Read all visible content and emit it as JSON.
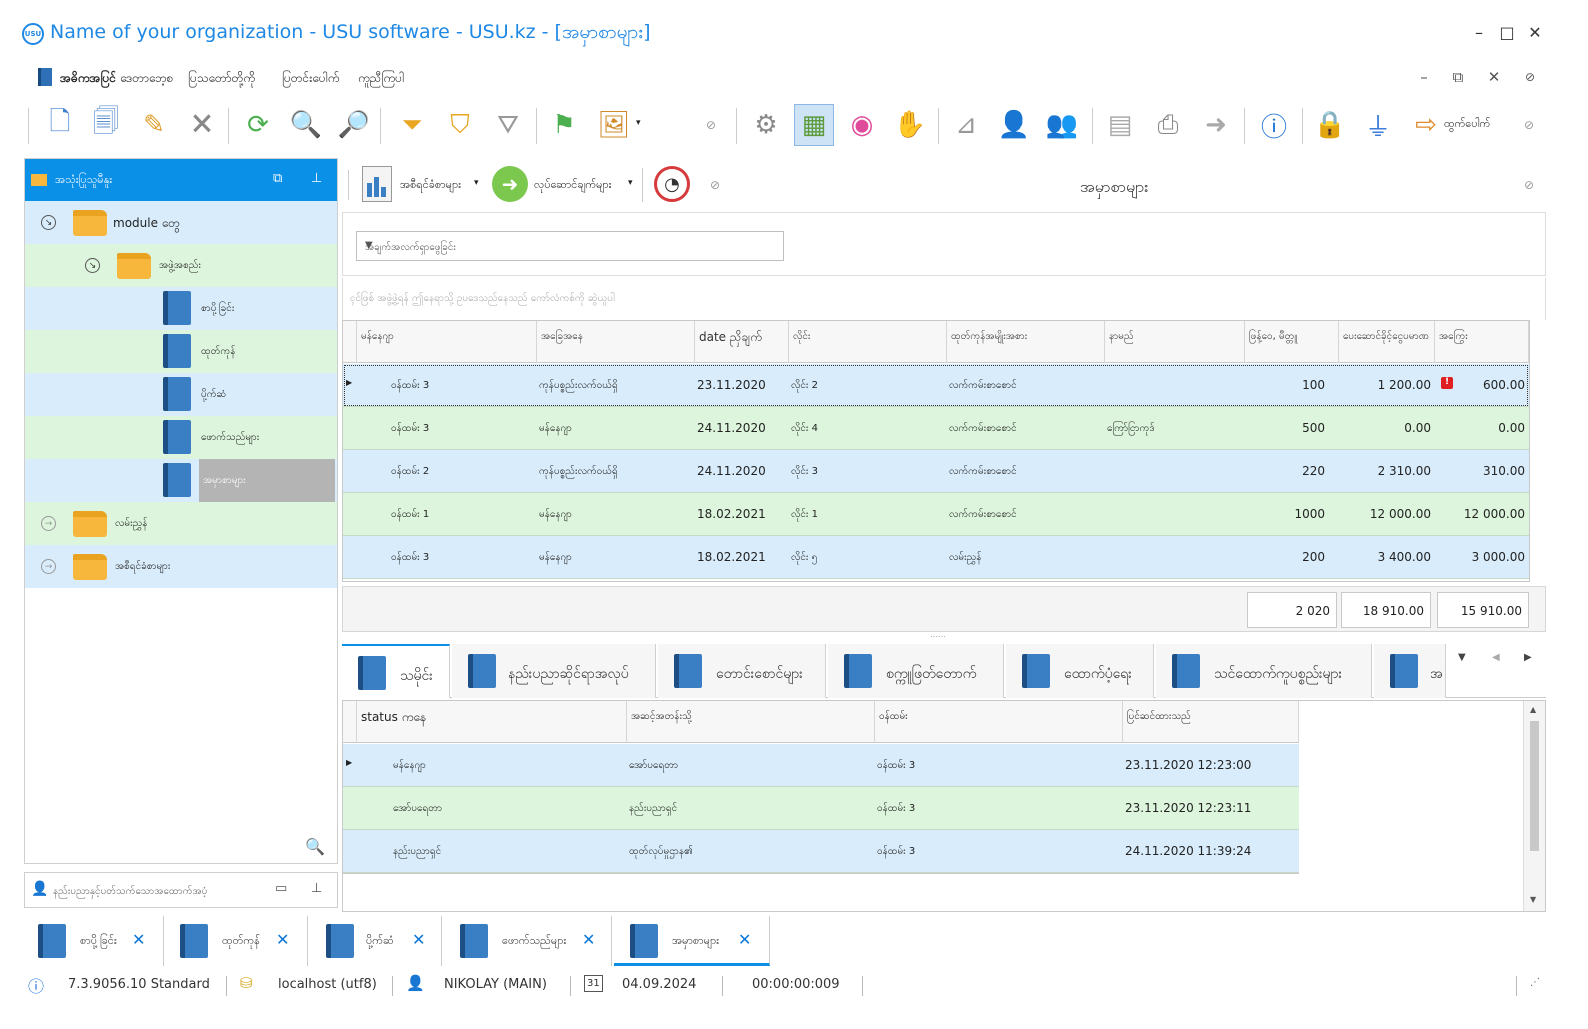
{
  "window": {
    "logo": "USU",
    "title": "Name of your organization - USU software - USU.kz - [အမှာစာများ]",
    "minimize": "–",
    "maximize": "□",
    "close": "✕"
  },
  "menu": {
    "items": [
      "အဓိကအပြင်",
      "ဒေတာဘေ့စ",
      "ပြသတော်တို့ကို",
      "ပြတင်းပေါက်",
      "ကူညီကြပါ"
    ]
  },
  "mdi": {
    "minimize": "–",
    "restore": "⧉",
    "close": "✕"
  },
  "toolbar": {
    "logout_label": "ထွက်ပေါက်"
  },
  "nav": {
    "header": "အသုံးပြုသူမီနူး",
    "tree": [
      {
        "label": "module တွေ",
        "level": 0,
        "kind": "folder",
        "color": "blue"
      },
      {
        "label": "အဖွဲ့အစည်း",
        "level": 1,
        "kind": "folder",
        "color": "green"
      },
      {
        "label": "စာပို့ခြင်း",
        "level": 2,
        "kind": "book",
        "color": "blue"
      },
      {
        "label": "ထုတ်ကုန်",
        "level": 2,
        "kind": "book",
        "color": "green"
      },
      {
        "label": "ပို့က်ဆံ",
        "level": 2,
        "kind": "book",
        "color": "blue"
      },
      {
        "label": "ဖောက်သည်များ",
        "level": 2,
        "kind": "book",
        "color": "green"
      },
      {
        "label": "အမှာစာများ",
        "level": 2,
        "kind": "book",
        "color": "blue"
      },
      {
        "label": "လမ်းညွှန်",
        "level": 0,
        "kind": "folder",
        "color": "green"
      },
      {
        "label": "အစီရင်ခံစာများ",
        "level": 0,
        "kind": "folder",
        "color": "blue"
      }
    ],
    "user_strip": "နည်းပညာနှင့်ပတ်သက်သောအထောက်အပံ့"
  },
  "main": {
    "reports_btn": "အစီရင်ခံစာများ",
    "actions_btn": "လုပ်ဆောင်ချက်များ",
    "title": "အမှာစာများ",
    "filter_placeholder": "အချက်အလက်ရှာဖွေခြင်း",
    "group_hint": "ၚင်ဖြစ် အဖွဲ့ဖွဲ့ရန် ဤနေရာသို့ ဥပဒေသည်နေသည် ကော်လံကစ်ကို ဆွဲယူပါ"
  },
  "grid": {
    "columns": [
      "မန်နေဂျာ",
      "အခြေအနေ",
      "date ညှိချက်",
      "လိုင်း",
      "ထုတ်ကုန်အမျိုးအစား",
      "နာမည်",
      "ဖြန့်ဝေ, မီတ္တူ",
      "ပေးဆောင်ခိုင့်ငွေပမာဏ",
      "အကြွေး"
    ],
    "rows": [
      {
        "manager": "ဝန်ထမ်း 3",
        "status": "ကုန်ပစ္စည်းလက်ဝယ်ရှိ",
        "date": "23.11.2020",
        "line": "လိုင်း 2",
        "type": "လက်ကမ်းစာစောင်",
        "name": "",
        "qty": "100",
        "paid": "1 200.00",
        "debt": "600.00",
        "warn": "!"
      },
      {
        "manager": "ဝန်ထမ်း 3",
        "status": "မန်နေဂျာ",
        "date": "24.11.2020",
        "line": "လိုင်း 4",
        "type": "လက်ကမ်းစာစောင်",
        "name": "ကြော်ငြာကုဒ်",
        "qty": "500",
        "paid": "0.00",
        "debt": "0.00",
        "warn": ""
      },
      {
        "manager": "ဝန်ထမ်း 2",
        "status": "ကုန်ပစ္စည်းလက်ဝယ်ရှိ",
        "date": "24.11.2020",
        "line": "လိုင်း 3",
        "type": "လက်ကမ်းစာစောင်",
        "name": "",
        "qty": "220",
        "paid": "2 310.00",
        "debt": "310.00",
        "warn": ""
      },
      {
        "manager": "ဝန်ထမ်း 1",
        "status": "မန်နေဂျာ",
        "date": "18.02.2021",
        "line": "လိုင်း 1",
        "type": "လက်ကမ်းစာစောင်",
        "name": "",
        "qty": "1000",
        "paid": "12 000.00",
        "debt": "12 000.00",
        "warn": ""
      },
      {
        "manager": "ဝန်ထမ်း 3",
        "status": "မန်နေဂျာ",
        "date": "18.02.2021",
        "line": "လိုင်း ၅",
        "type": "လမ်းညွှန်",
        "name": "",
        "qty": "200",
        "paid": "3 400.00",
        "debt": "3 000.00",
        "warn": ""
      }
    ],
    "totals": {
      "qty": "2 020",
      "paid": "18 910.00",
      "debt": "15 910.00"
    }
  },
  "detail_tabs": [
    "သမိုင်း",
    "နည်းပညာဆိုင်ရာအလုပ်",
    "တောင်းစောင်များ",
    "စက္ကူဖြတ်တောက်",
    "ထောက်ပံ့ရေး",
    "သင်ထောက်ကူပစ္စည်းများ",
    "အ"
  ],
  "detail_grid": {
    "columns": [
      "status ကနေ",
      "အဆင့်အတန်းသို့",
      "ဝန်ထမ်း",
      "ပြင်ဆင်ထားသည်"
    ],
    "rows": [
      {
        "from": "မန်နေဂျာ",
        "to": "အော်ပရေတာ",
        "employee": "ဝန်ထမ်း 3",
        "modified": "23.11.2020 12:23:00"
      },
      {
        "from": "အော်ပရေတာ",
        "to": "နည်းပညာရှင်",
        "employee": "ဝန်ထမ်း 3",
        "modified": "23.11.2020 12:23:11"
      },
      {
        "from": "နည်းပညာရှင်",
        "to": "ထုတ်လုပ်မှုဌာန၏",
        "employee": "ဝန်ထမ်း 3",
        "modified": "24.11.2020 11:39:24"
      }
    ]
  },
  "doc_tabs": [
    "စာပို့ခြင်း",
    "ထုတ်ကုန်",
    "ပို့က်ဆံ",
    "ဖောက်သည်များ",
    "အမှာစာများ"
  ],
  "status": {
    "version": "7.3.9056.10 Standard",
    "server": "localhost (utf8)",
    "user": "NIKOLAY (MAIN)",
    "calendar_day": "31",
    "date": "04.09.2024",
    "timer": "00:00:00:009"
  },
  "colors": {
    "accent": "#0b90e8",
    "row_blue": "#d8ecfb",
    "row_green": "#dcf5dc",
    "title": "#1e88e5"
  }
}
